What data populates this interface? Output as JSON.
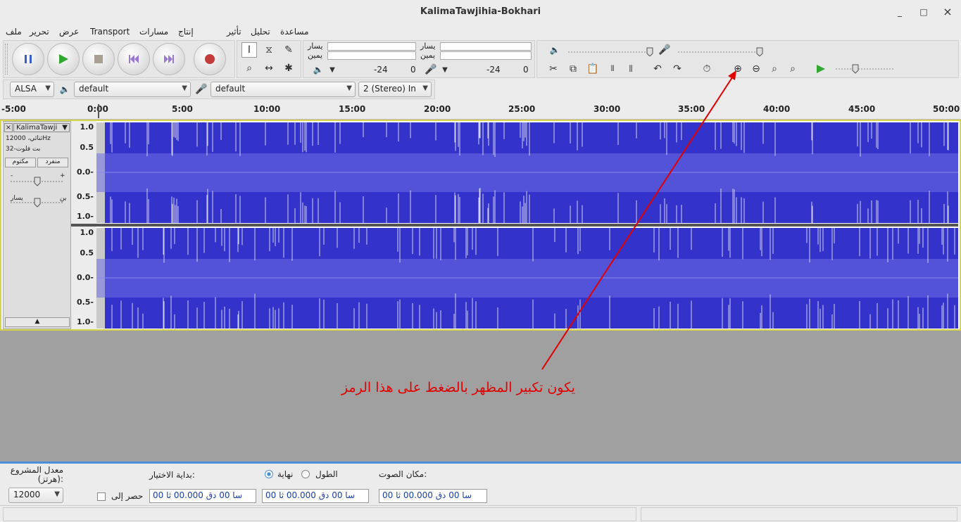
{
  "window": {
    "title": "KalimaTawjihia-Bokhari",
    "minimize": "_",
    "maximize": "□",
    "close": "×"
  },
  "menu": {
    "file": "ملف",
    "edit": "تحرير",
    "view": "عرض",
    "transport": "Transport",
    "tracks": "مسارات",
    "generate": "إنتاج",
    "effect": "تأثير",
    "analyze": "تحليل",
    "help": "مساعدة"
  },
  "meters": {
    "play_left": "يسار",
    "play_right": "يمين",
    "rec_left": "يسار",
    "rec_right": "يمين",
    "play_db_a": "-24",
    "play_db_b": "0",
    "rec_db_a": "-24",
    "rec_db_b": "0"
  },
  "device": {
    "host": "ALSA",
    "playback": "default",
    "recording": "default",
    "channels": "2 (Stereo) In"
  },
  "ruler": [
    "-5:00",
    "0:00",
    "5:00",
    "10:00",
    "15:00",
    "20:00",
    "25:00",
    "30:00",
    "35:00",
    "40:00",
    "45:00",
    "50:00"
  ],
  "track": {
    "name": "KalimaTawji",
    "info1": "ثنائي، 12000Hz",
    "info2": "32-بت فلوت",
    "mute": "مكتوم",
    "solo": "منفرد",
    "gain_minus": "-",
    "gain_plus": "+",
    "pan_left": "يسار",
    "pan_right": "ين",
    "scale": [
      "1.0",
      "0.5",
      "0.0-",
      "0.5-",
      "1.0-"
    ]
  },
  "annotation": "يكون تكبير المظهر بالضغط على هذا الرمز",
  "selection": {
    "rate_label": "معدل المشروع (هرتز):",
    "rate_value": "12000",
    "snap_label": "حصر إلى",
    "start_label": "بداية الاختيار:",
    "end_radio": "نهاية",
    "length_radio": "الطول",
    "pos_label": "مكان الصوت:",
    "time1": "00 سا 00 دق 00.000 ثا",
    "time2": "00 سا 00 دق 00.000 ثا",
    "time3": "00 سا 00 دق 00.000 ثا"
  }
}
